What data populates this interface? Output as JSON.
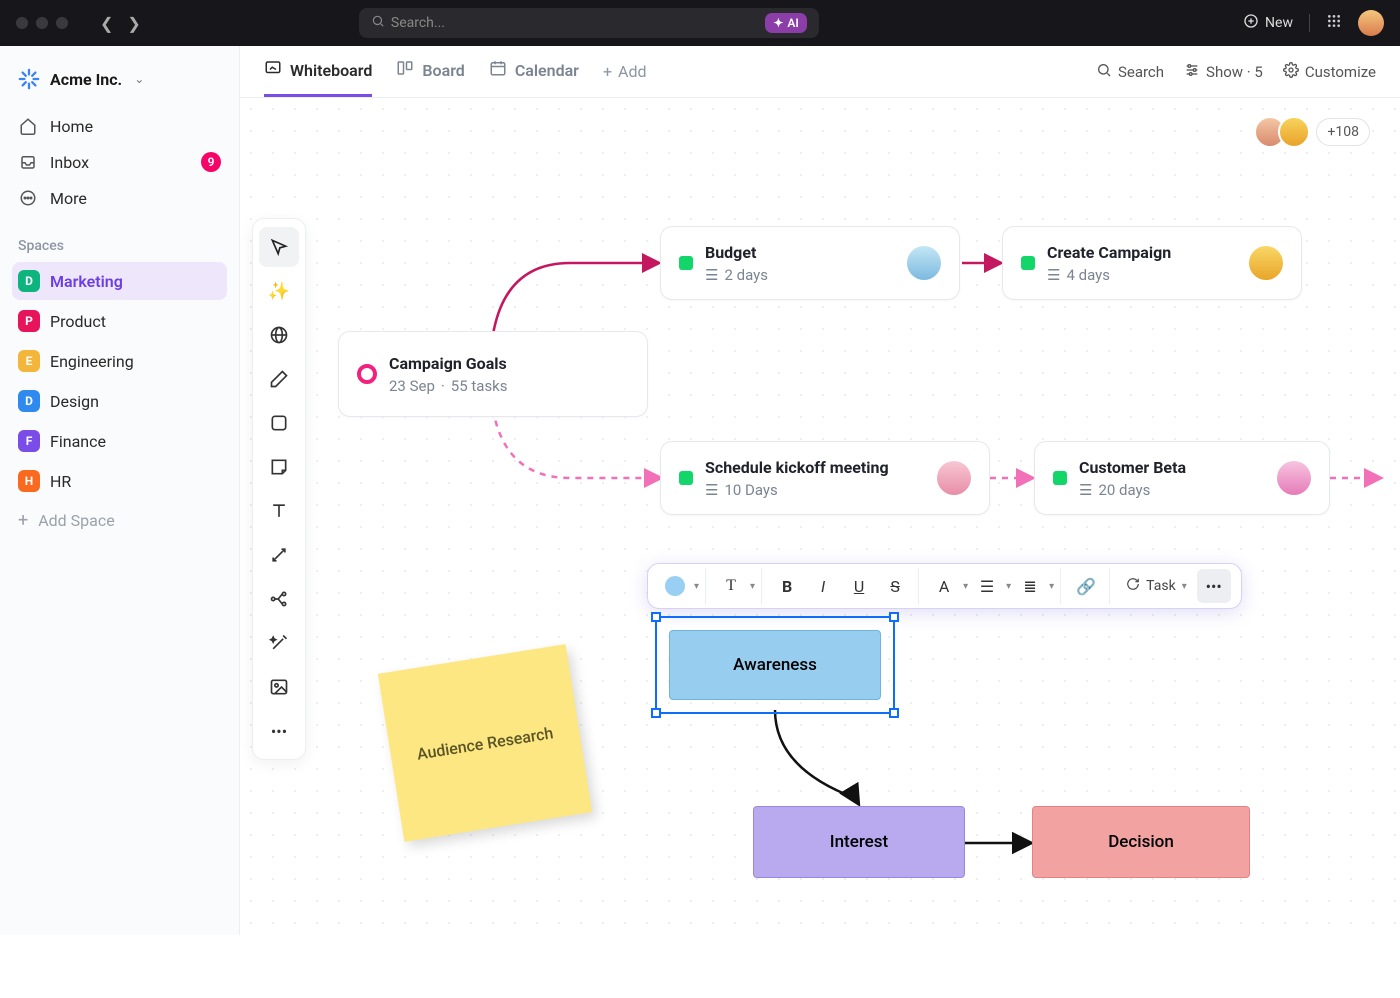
{
  "titlebar": {
    "search_placeholder": "Search...",
    "ai_label": "AI",
    "new_label": "New"
  },
  "workspace": {
    "name": "Acme Inc."
  },
  "nav": {
    "home": "Home",
    "inbox": "Inbox",
    "inbox_badge": "9",
    "more": "More"
  },
  "spaces_heading": "Spaces",
  "spaces": [
    {
      "letter": "D",
      "name": "Marketing",
      "color": "#0db47e"
    },
    {
      "letter": "P",
      "name": "Product",
      "color": "#e7145b"
    },
    {
      "letter": "E",
      "name": "Engineering",
      "color": "#f3b63a"
    },
    {
      "letter": "D",
      "name": "Design",
      "color": "#2f8af0"
    },
    {
      "letter": "F",
      "name": "Finance",
      "color": "#7a4de8"
    },
    {
      "letter": "H",
      "name": "HR",
      "color": "#f96a1e"
    }
  ],
  "add_space": "Add Space",
  "tabs": {
    "whiteboard": "Whiteboard",
    "board": "Board",
    "calendar": "Calendar",
    "add": "Add"
  },
  "view_actions": {
    "search": "Search",
    "show": "Show · 5",
    "customize": "Customize"
  },
  "collab": {
    "more": "+108"
  },
  "cards": {
    "goals": {
      "title": "Campaign Goals",
      "date": "23 Sep",
      "tasks": "55 tasks"
    },
    "budget": {
      "title": "Budget",
      "duration": "2 days"
    },
    "campaign": {
      "title": "Create Campaign",
      "duration": "4 days"
    },
    "kickoff": {
      "title": "Schedule kickoff meeting",
      "duration": "10 Days"
    },
    "beta": {
      "title": "Customer Beta",
      "duration": "20 days"
    }
  },
  "sticky": "Audience Research",
  "flow": {
    "awareness": "Awareness",
    "interest": "Interest",
    "decision": "Decision"
  },
  "text_toolbar": {
    "task": "Task"
  }
}
